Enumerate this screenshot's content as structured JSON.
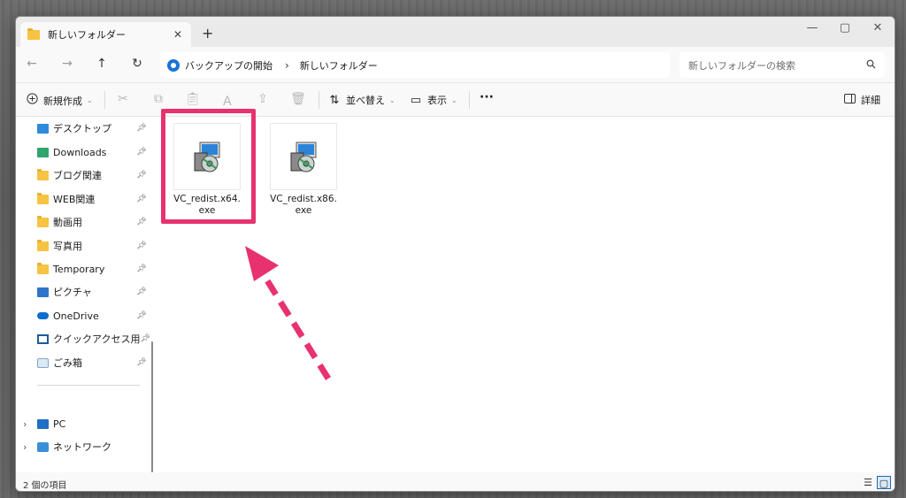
{
  "window": {
    "tab_title": "新しいフォルダー",
    "new_tab": "+",
    "controls": {
      "minimize": "—",
      "maximize": "▢",
      "close": "✕"
    }
  },
  "address": {
    "back": "←",
    "forward": "→",
    "up": "↑",
    "refresh": "↻",
    "crumbs": [
      "バックアップの開始",
      "新しいフォルダー"
    ],
    "separator": "›",
    "search_placeholder": "新しいフォルダーの検索"
  },
  "toolbar": {
    "new_label": "新規作成",
    "sort_label": "並べ替え",
    "view_label": "表示",
    "more": "···",
    "details_label": "詳細",
    "disabled_icons": [
      "cut-icon",
      "copy-icon",
      "paste-icon",
      "rename-icon",
      "share-icon",
      "delete-icon"
    ]
  },
  "sidebar": {
    "items": [
      {
        "label": "デスクトップ",
        "icon": "desktop-icon",
        "pinned": true
      },
      {
        "label": "Downloads",
        "icon": "downloads-icon",
        "pinned": true
      },
      {
        "label": "ブログ関連",
        "icon": "folder-icon",
        "pinned": true
      },
      {
        "label": "WEB関連",
        "icon": "folder-icon",
        "pinned": true
      },
      {
        "label": "動画用",
        "icon": "folder-icon",
        "pinned": true
      },
      {
        "label": "写真用",
        "icon": "folder-icon",
        "pinned": true
      },
      {
        "label": "Temporary",
        "icon": "folder-icon",
        "pinned": true
      },
      {
        "label": "ピクチャ",
        "icon": "pictures-icon",
        "pinned": true
      },
      {
        "label": "OneDrive",
        "icon": "onedrive-icon",
        "pinned": true
      },
      {
        "label": "クイックアクセス用",
        "icon": "quick-access-icon",
        "pinned": true
      },
      {
        "label": "ごみ箱",
        "icon": "recycle-bin-icon",
        "pinned": true
      }
    ],
    "roots": [
      {
        "label": "PC",
        "icon": "pc-icon"
      },
      {
        "label": "ネットワーク",
        "icon": "network-icon"
      }
    ]
  },
  "files": [
    {
      "name": "VC_redist.x64.exe",
      "selected_highlight": true
    },
    {
      "name": "VC_redist.x86.exe",
      "selected_highlight": false
    }
  ],
  "status": {
    "item_count": "2 個の項目"
  },
  "colors": {
    "highlight": "#e8326f",
    "folder": "#f6c343",
    "accent": "#1a73d9"
  }
}
